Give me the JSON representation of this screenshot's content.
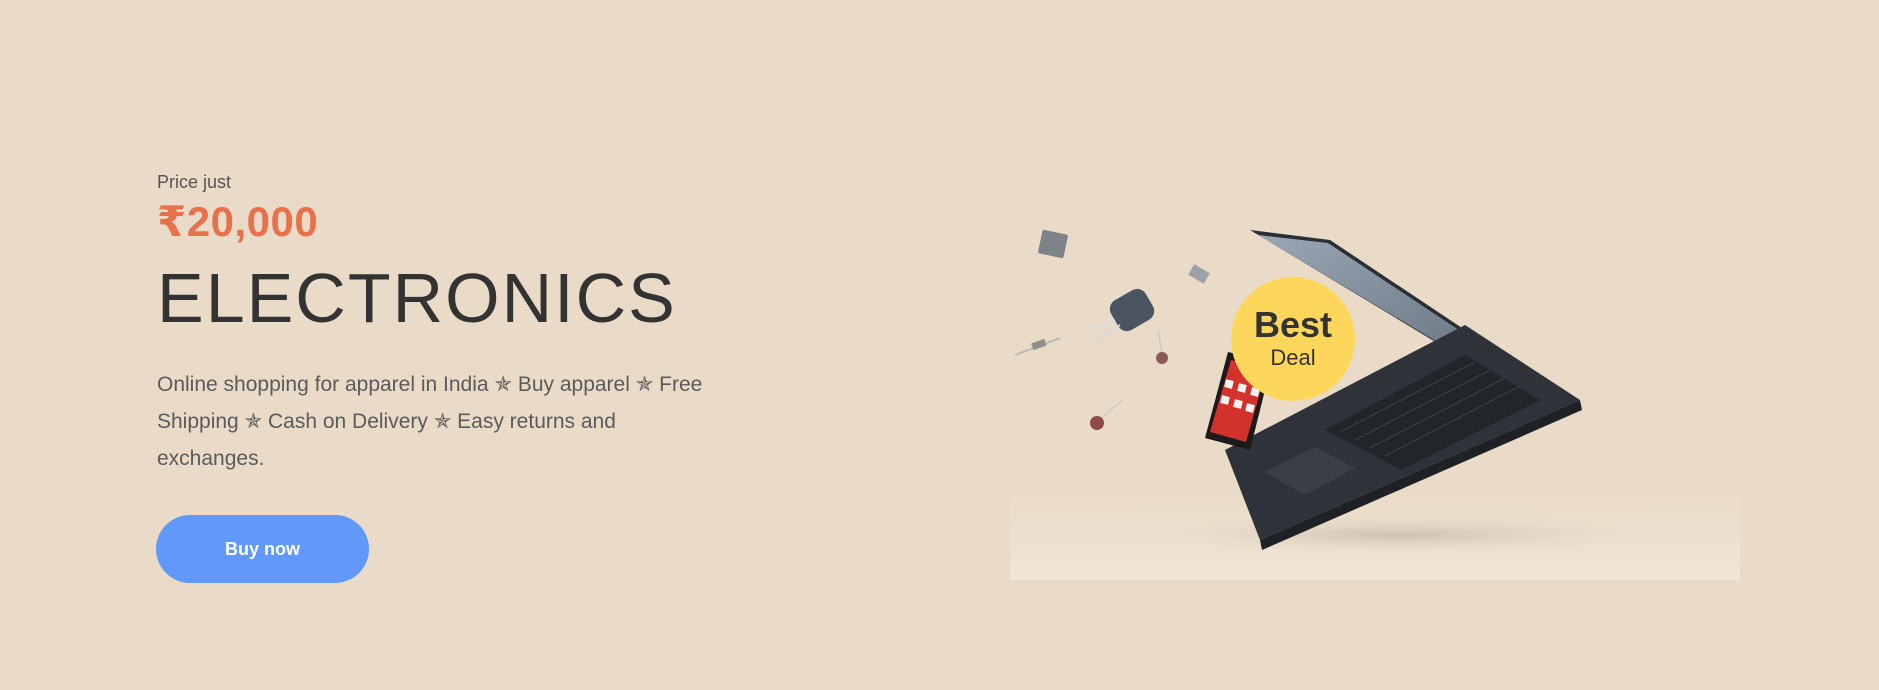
{
  "hero": {
    "price_label": "Price just",
    "price": "₹20,000",
    "title": "ELECTRONICS",
    "description": "Online shopping for apparel in India ✯ Buy apparel ✯ Free Shipping ✯ Cash on Delivery ✯ Easy returns and exchanges.",
    "button_label": "Buy now"
  },
  "badge": {
    "top": "Best",
    "bottom": "Deal"
  },
  "colors": {
    "background": "#e9dbc7",
    "price": "#e8704a",
    "button": "#6199fb",
    "badge": "#fcd75c"
  },
  "icons": [
    "laptop-illustration",
    "phone-illustration",
    "electronic-components-illustration"
  ]
}
